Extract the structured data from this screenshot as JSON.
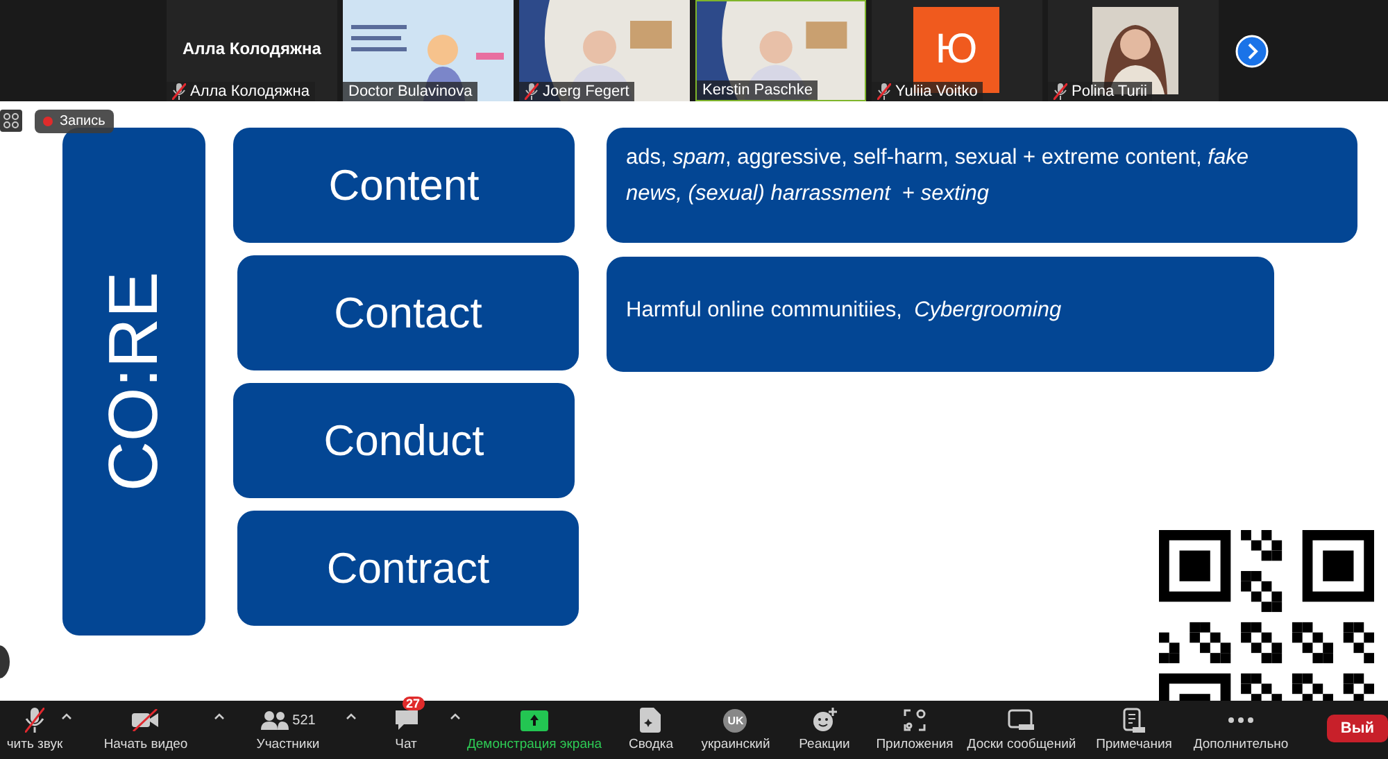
{
  "participants": [
    {
      "kind": "name",
      "name": "Алла Колодяжна",
      "display_name": "Алла Колодяжна",
      "muted": true,
      "speaking": false
    },
    {
      "kind": "poster",
      "name": "Doctor Bulavinova",
      "muted": false,
      "speaking": false
    },
    {
      "kind": "video",
      "name": "Joerg Fegert",
      "muted": true,
      "speaking": false
    },
    {
      "kind": "video",
      "name": "Kerstin Paschke",
      "muted": false,
      "speaking": true
    },
    {
      "kind": "avatar",
      "initial": "Ю",
      "name": "Yuliia Voitko",
      "muted": true,
      "speaking": false
    },
    {
      "name": "Polina Turii",
      "muted": true,
      "speaking": false
    }
  ],
  "recording": {
    "label": "Запись"
  },
  "slide": {
    "title": "CO:RE",
    "categories": [
      {
        "label": "Content",
        "description": "ads, *spam*, aggressive, self-harm, sexual + extreme content, *fake news, (sexual) harrassment*  + *sexting*"
      },
      {
        "label": "Contact",
        "description": "Harmful online communitiies,  *Cybergrooming*"
      },
      {
        "label": "Conduct"
      },
      {
        "label": "Contract"
      }
    ]
  },
  "toolbar": {
    "items": [
      {
        "kind": "mic",
        "label": "чить звук",
        "muted": true,
        "caret": true
      },
      {
        "kind": "video",
        "label": "Начать видео",
        "muted": true,
        "caret": true
      },
      {
        "kind": "people",
        "label": "Участники",
        "count": "521",
        "caret": true
      },
      {
        "kind": "chat",
        "label": "Чат",
        "badge": "27",
        "caret": true
      },
      {
        "kind": "share",
        "label": "Демонстрация экрана",
        "caret": false
      },
      {
        "kind": "summary",
        "label": "Сводка",
        "caret": false
      },
      {
        "kind": "language",
        "label": "украинский",
        "icon_text": "UK",
        "caret": false
      },
      {
        "kind": "reaction",
        "label": "Реакции",
        "caret": false
      },
      {
        "kind": "apps",
        "label": "Приложения",
        "caret": false
      },
      {
        "kind": "board",
        "label": "Доски сообщений",
        "caret": false
      },
      {
        "kind": "notes",
        "label": "Примечания",
        "caret": false
      },
      {
        "kind": "more",
        "label": "Дополнительно",
        "caret": false
      }
    ],
    "leave": {
      "label": "Вый"
    }
  }
}
